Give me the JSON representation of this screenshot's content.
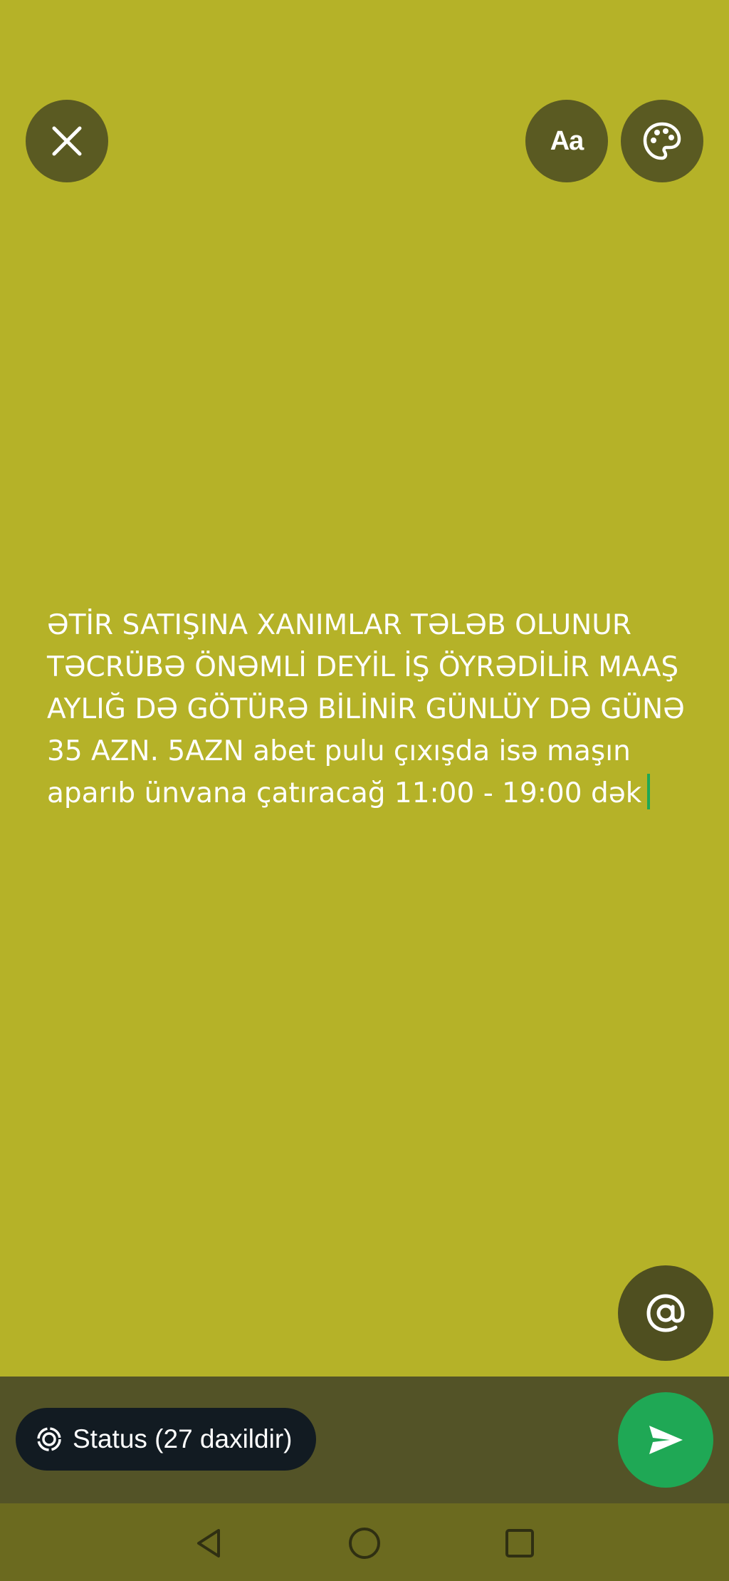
{
  "toolbar": {
    "close_icon": "close-icon",
    "font_label": "Aa",
    "palette_icon": "palette-icon"
  },
  "status": {
    "text": "ƏTİR SATIŞINA XANIMLAR TƏLƏB OLUNUR TƏCRÜBƏ ÖNƏMLİ DEYİL İŞ ÖYRƏDİLİR MAAŞ AYLIĞ DƏ GÖTÜRƏ BİLİNİR GÜNLÜY DƏ GÜNƏ 35 AZN. 5AZN abet pulu çıxışda isə maşın aparıb ünvana çatıracağ 11:00 - 19:00 dək",
    "background_color": "#b5b228",
    "caret_color": "#1fa855"
  },
  "mention": {
    "icon": "at-sign-icon"
  },
  "footer": {
    "audience_icon": "status-ring-icon",
    "audience_label": "Status (27 daxildir)",
    "send_icon": "send-icon",
    "send_color": "#1fa855"
  },
  "navigation": {
    "back_icon": "back-triangle-icon",
    "home_icon": "home-circle-icon",
    "recents_icon": "recents-square-icon"
  }
}
